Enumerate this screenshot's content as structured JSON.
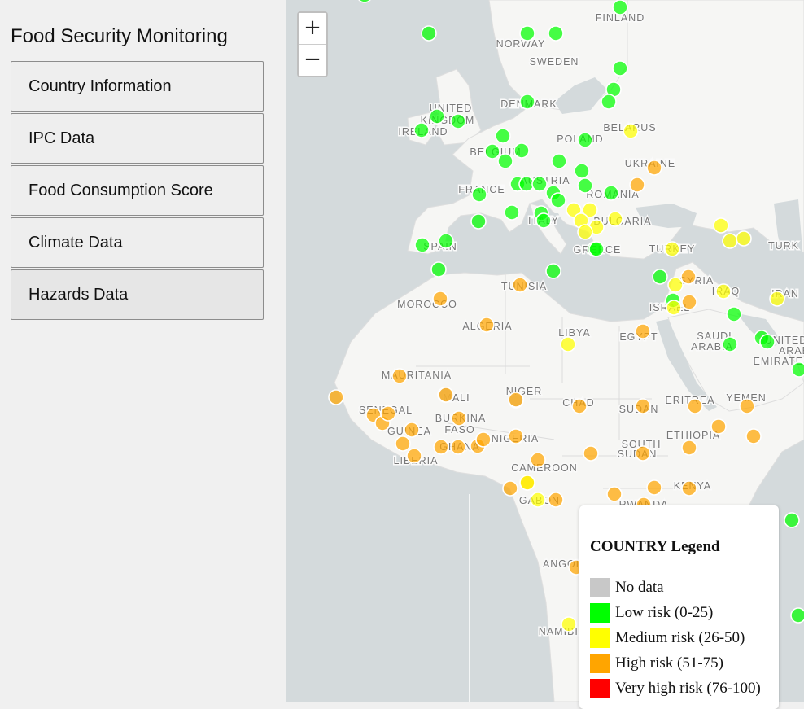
{
  "sidebar": {
    "title": "Food Security Monitoring",
    "buttons": [
      {
        "label": "Country Information"
      },
      {
        "label": "IPC Data"
      },
      {
        "label": "Food Consumption Score"
      },
      {
        "label": "Climate Data"
      },
      {
        "label": "Hazards Data"
      }
    ]
  },
  "map": {
    "zoom_in": "+",
    "zoom_out": "−",
    "labels": [
      "FINLAND",
      "NORWAY",
      "SWEDEN",
      "UNITED",
      "KINGDOM",
      "IRELAND",
      "DENMARK",
      "BELARUS",
      "POLAND",
      "BELGIUM",
      "UKRAINE",
      "FRANCE",
      "AUSTRIA",
      "ROMANIA",
      "ITALY",
      "BULGARIA",
      "SPAIN",
      "GREECE",
      "TURKEY",
      "TURK",
      "TUNISIA",
      "SYRIA",
      "IRAQ",
      "IRAN",
      "MOROCCO",
      "ISRAEL",
      "ALGERIA",
      "LIBYA",
      "EGYPT",
      "SAUDI",
      "ARABIA",
      "UNITED",
      "ARAB",
      "EMIRATES",
      "MAURITANIA",
      "NIGER",
      "MALI",
      "CHAD",
      "ERITREA",
      "YEMEN",
      "SENEGAL",
      "SUDAN",
      "BURKINA",
      "FASO",
      "GUINEA",
      "NIGERIA",
      "ETHIOPIA",
      "SOUTH",
      "SUDAN",
      "LIBERIA",
      "GHANA",
      "CAMEROON",
      "KENYA",
      "GABON",
      "RWANDA",
      "ANGOLA",
      "NAMIBIA"
    ]
  },
  "legend": {
    "title": "COUNTRY Legend",
    "items": [
      {
        "label": "No data",
        "color": "#c8c8c8"
      },
      {
        "label": "Low risk (0-25)",
        "color": "#00ff00"
      },
      {
        "label": "Medium risk (26-50)",
        "color": "#ffff00"
      },
      {
        "label": "High risk (51-75)",
        "color": "#ffa500"
      },
      {
        "label": "Very high risk (76-100)",
        "color": "#ff0000"
      }
    ]
  }
}
